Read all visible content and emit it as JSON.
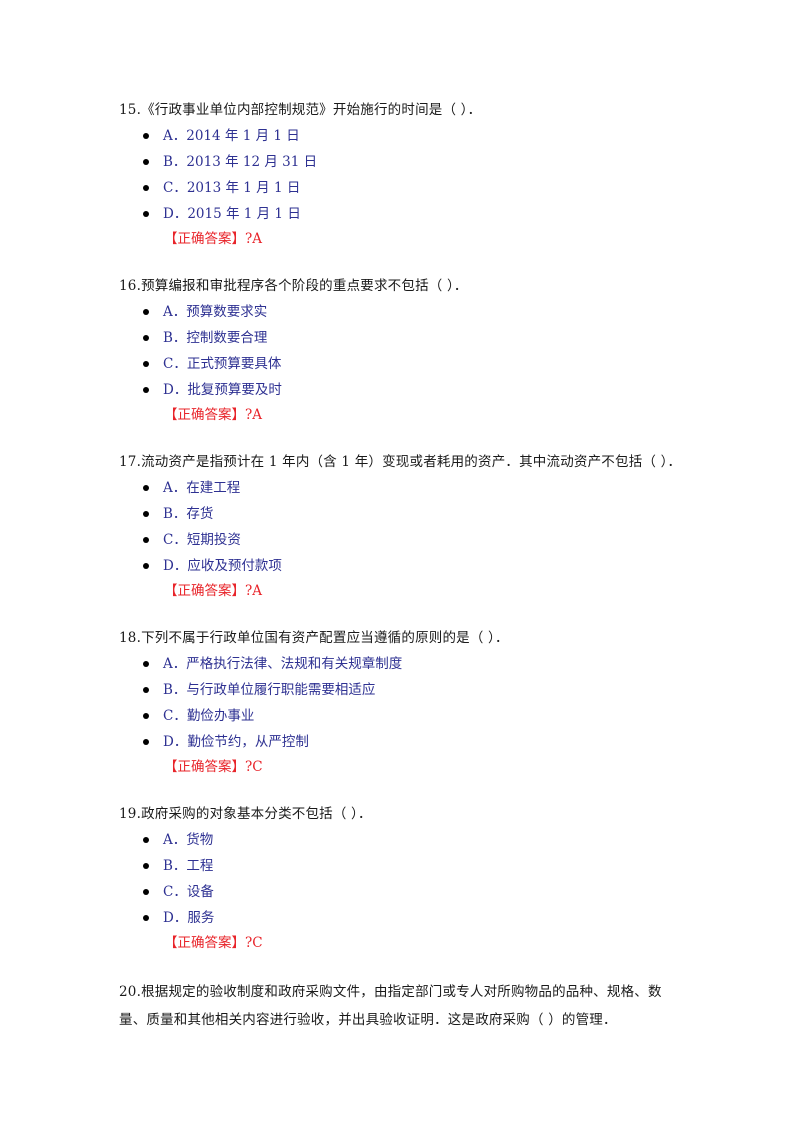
{
  "questions": [
    {
      "stem": "15.《行政事业单位内部控制规范》开始施行的时间是（ ）．",
      "options": [
        "A．2014 年 1 月 1 日",
        "B．2013 年 12 月 31 日",
        "C．2013 年 1 月 1 日",
        "D．2015 年 1 月 1 日"
      ],
      "answer": "【正确答案】?A"
    },
    {
      "stem": "16.预算编报和审批程序各个阶段的重点要求不包括（ ）．",
      "options": [
        "A．预算数要求实",
        "B．控制数要合理",
        "C．正式预算要具体",
        "D．批复预算要及时"
      ],
      "answer": "【正确答案】?A"
    },
    {
      "stem": "17.流动资产是指预计在 1 年内（含 1 年）变现或者耗用的资产．其中流动资产不包括（ ）．",
      "options": [
        "A．在建工程",
        "B．存货",
        "C．短期投资",
        "D．应收及预付款项"
      ],
      "answer": "【正确答案】?A"
    },
    {
      "stem": "18.下列不属于行政单位国有资产配置应当遵循的原则的是（ ）．",
      "options": [
        "A．严格执行法律、法规和有关规章制度",
        "B．与行政单位履行职能需要相适应",
        "C．勤俭办事业",
        "D．勤俭节约，从严控制"
      ],
      "answer": "【正确答案】?C"
    },
    {
      "stem": "19.政府采购的对象基本分类不包括（ ）．",
      "options": [
        "A．货物",
        "B．工程",
        "C．设备",
        "D．服务"
      ],
      "answer": "【正确答案】?C"
    },
    {
      "stem": "20.根据规定的验收制度和政府采购文件，由指定部门或专人对所购物品的品种、规格、数量、质量和其他相关内容进行验收，并出具验收证明．这是政府采购（ ）的管理．"
    }
  ],
  "colors": {
    "stem_text": "#1a1a1a",
    "option_text": "#2e3192",
    "answer_text": "#e8242a"
  }
}
